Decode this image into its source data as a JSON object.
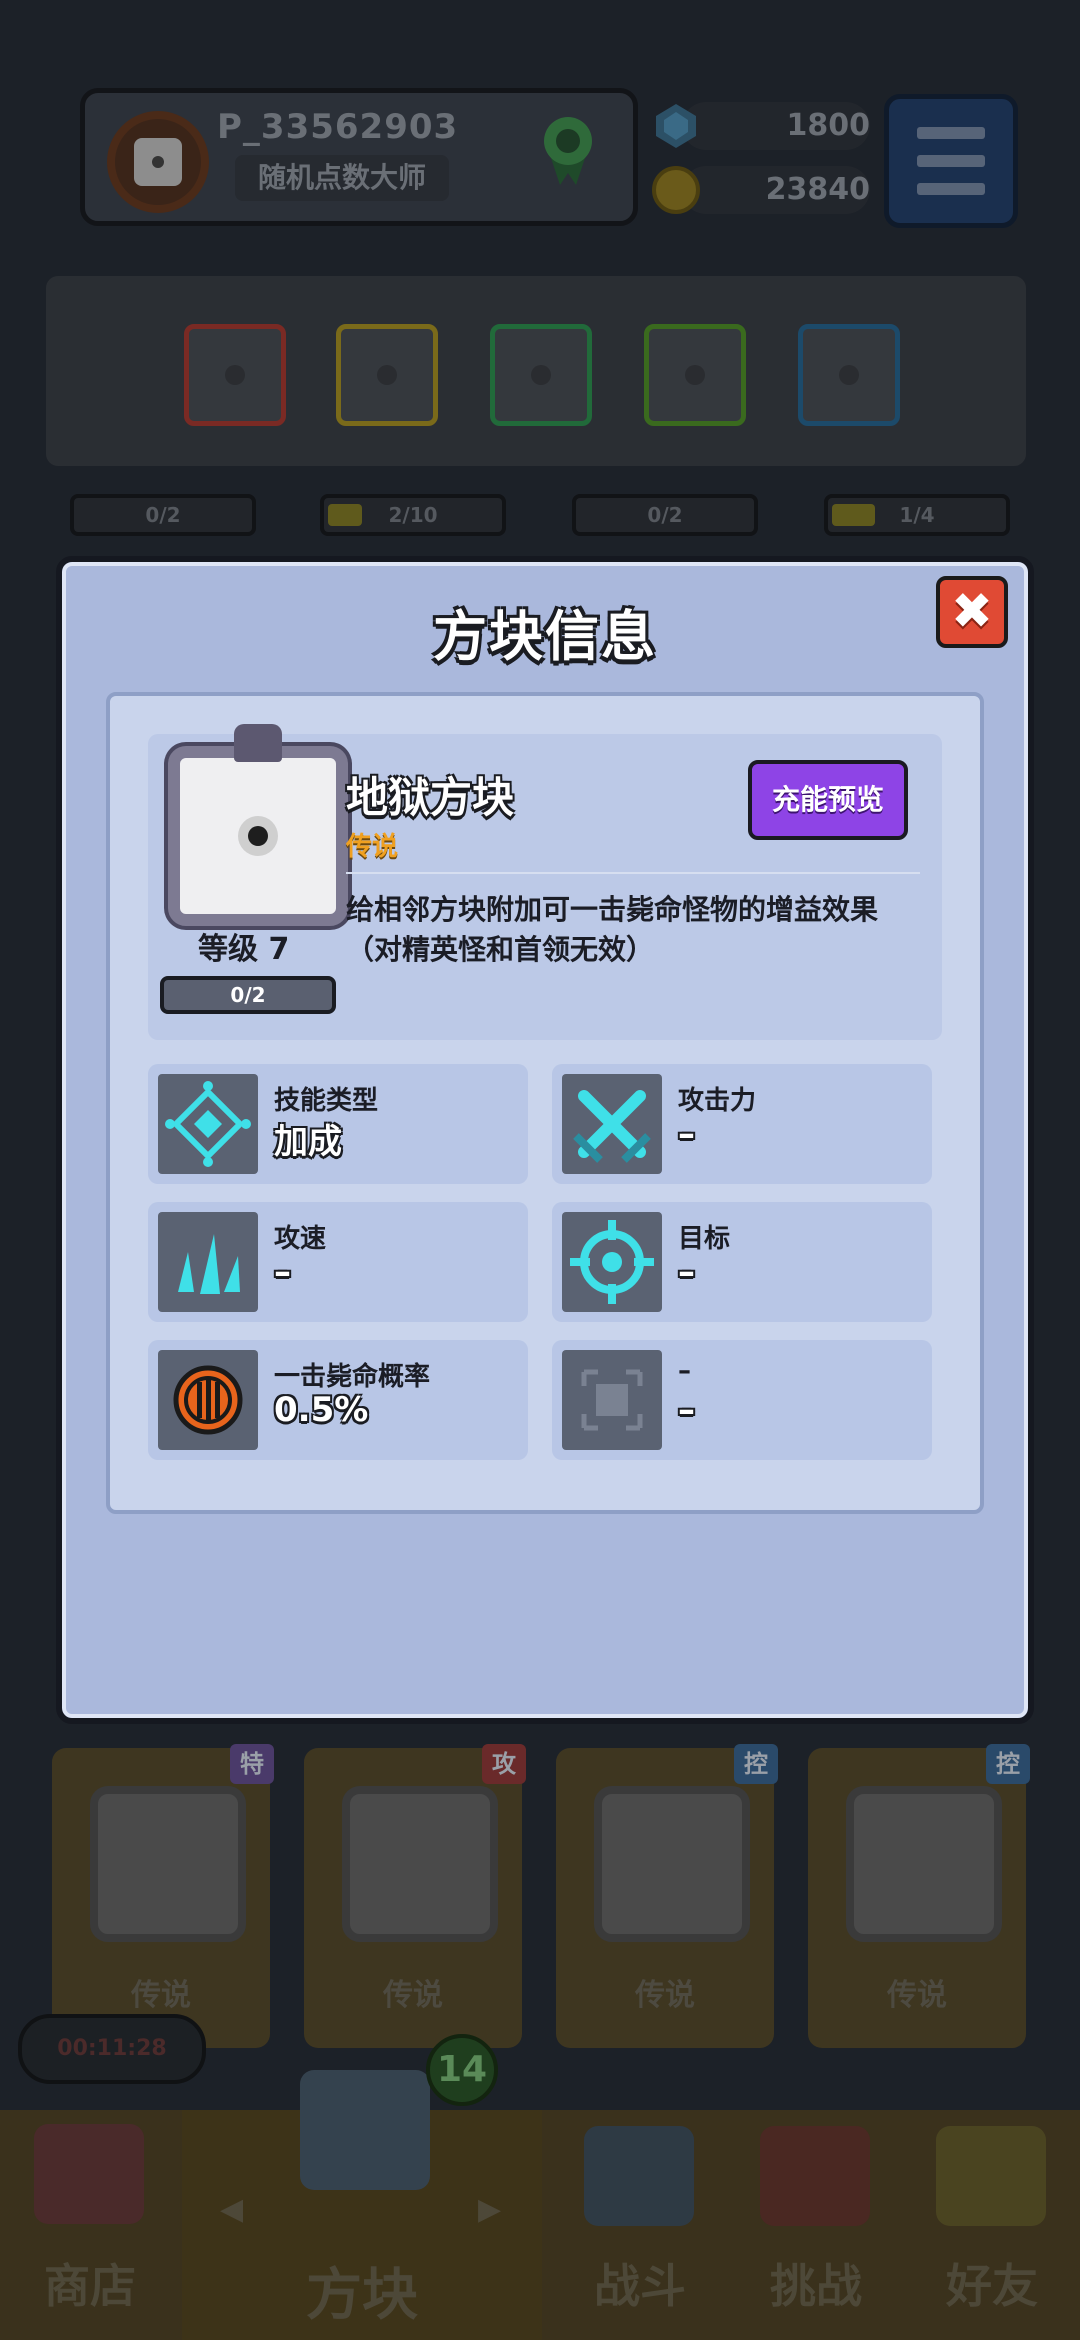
{
  "player": {
    "id": "P_33562903",
    "title": "随机点数大师"
  },
  "currency": {
    "gems": "1800",
    "coins": "23840"
  },
  "deck": {
    "slot_colors": [
      "#7a2a24",
      "#7a6a1a",
      "#216a3a",
      "#3a6a1e",
      "#1c4a6a"
    ],
    "progress": [
      {
        "label": "0/2",
        "fill": 0
      },
      {
        "label": "2/10",
        "fill": 0.2
      },
      {
        "label": "0/2",
        "fill": 0
      },
      {
        "label": "1/4",
        "fill": 0.25
      }
    ]
  },
  "dialog": {
    "title": "方块信息",
    "close_label": "✖",
    "block": {
      "name": "地狱方块",
      "rarity": "传说",
      "level_label": "等级",
      "level": "7",
      "progress": "0/2",
      "charge_button": "充能预览",
      "description": "给相邻方块附加可一击毙命怪物的增益效果（对精英怪和首领无效）"
    },
    "stats": [
      {
        "label": "技能类型",
        "value": "加成",
        "icon": "skill-type-icon"
      },
      {
        "label": "攻击力",
        "value": "–",
        "icon": "crossed-swords-icon"
      },
      {
        "label": "攻速",
        "value": "–",
        "icon": "attack-speed-icon"
      },
      {
        "label": "目标",
        "value": "–",
        "icon": "target-icon"
      },
      {
        "label": "一击毙命概率",
        "value": "0.5%",
        "icon": "instakill-icon"
      },
      {
        "label": "–",
        "value": "–",
        "icon": "empty-slot-icon"
      }
    ]
  },
  "cards": [
    {
      "tag": "特",
      "rarity": "传说",
      "tag_color": "#4a3a6a"
    },
    {
      "tag": "攻",
      "rarity": "传说",
      "tag_color": "#6a2a2a"
    },
    {
      "tag": "控",
      "rarity": "传说",
      "tag_color": "#2a4a6a"
    },
    {
      "tag": "控",
      "rarity": "传说",
      "tag_color": "#2a4a6a"
    }
  ],
  "timer": "00:11:28",
  "box_count": "14",
  "nav": {
    "shop": "商店",
    "blocks": "方块",
    "battle": "战斗",
    "challenge": "挑战",
    "friends": "好友"
  }
}
